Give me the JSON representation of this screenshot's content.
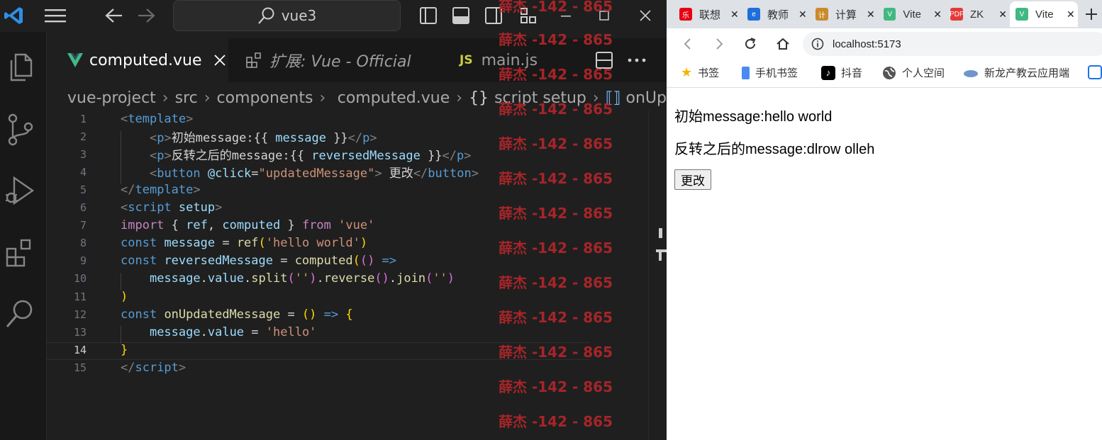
{
  "vscode": {
    "search_text": "vue3",
    "tabs": [
      {
        "label": "computed.vue",
        "icon": "vue-icon",
        "active": true
      },
      {
        "label": "扩展: Vue - Official",
        "icon": "extensions-icon",
        "active": false
      },
      {
        "label": "main.js",
        "icon": "js-file-icon",
        "active": false
      }
    ],
    "breadcrumb": [
      "vue-project",
      "src",
      "components",
      "computed.vue",
      "script setup",
      "onUp"
    ],
    "current_line": 14,
    "lines": [
      {
        "n": "1",
        "parts": [
          [
            "t-br",
            "<"
          ],
          [
            "t-tag",
            "template"
          ],
          [
            "t-br",
            ">"
          ]
        ]
      },
      {
        "n": "2",
        "parts": [
          [
            "t-txt",
            "    "
          ],
          [
            "t-br",
            "<"
          ],
          [
            "t-tag",
            "p"
          ],
          [
            "t-br",
            ">"
          ],
          [
            "t-txt",
            "初始message:{{ "
          ],
          [
            "t-var",
            "message"
          ],
          [
            "t-txt",
            " }}"
          ],
          [
            "t-br",
            "</"
          ],
          [
            "t-tag",
            "p"
          ],
          [
            "t-br",
            ">"
          ]
        ]
      },
      {
        "n": "3",
        "parts": [
          [
            "t-txt",
            "    "
          ],
          [
            "t-br",
            "<"
          ],
          [
            "t-tag",
            "p"
          ],
          [
            "t-br",
            ">"
          ],
          [
            "t-txt",
            "反转之后的message:{{ "
          ],
          [
            "t-var",
            "reversedMessage"
          ],
          [
            "t-txt",
            " }}"
          ],
          [
            "t-br",
            "</"
          ],
          [
            "t-tag",
            "p"
          ],
          [
            "t-br",
            ">"
          ]
        ]
      },
      {
        "n": "4",
        "parts": [
          [
            "t-txt",
            "    "
          ],
          [
            "t-br",
            "<"
          ],
          [
            "t-tag",
            "button"
          ],
          [
            "t-txt",
            " "
          ],
          [
            "t-attr",
            "@click"
          ],
          [
            "t-op",
            "="
          ],
          [
            "t-str",
            "\"updatedMessage\""
          ],
          [
            "t-br",
            ">"
          ],
          [
            "t-txt",
            " 更改"
          ],
          [
            "t-br",
            "</"
          ],
          [
            "t-tag",
            "button"
          ],
          [
            "t-br",
            ">"
          ]
        ]
      },
      {
        "n": "5",
        "parts": [
          [
            "t-br",
            "</"
          ],
          [
            "t-tag",
            "template"
          ],
          [
            "t-br",
            ">"
          ]
        ]
      },
      {
        "n": "6",
        "parts": [
          [
            "t-br",
            "<"
          ],
          [
            "t-tag",
            "script"
          ],
          [
            "t-txt",
            " "
          ],
          [
            "t-attr",
            "setup"
          ],
          [
            "t-br",
            ">"
          ]
        ]
      },
      {
        "n": "7",
        "parts": [
          [
            "t-kw",
            "import"
          ],
          [
            "t-txt",
            " { "
          ],
          [
            "t-var",
            "ref"
          ],
          [
            "t-txt",
            ", "
          ],
          [
            "t-var",
            "computed"
          ],
          [
            "t-txt",
            " } "
          ],
          [
            "t-kw",
            "from"
          ],
          [
            "t-txt",
            " "
          ],
          [
            "t-str",
            "'vue'"
          ]
        ]
      },
      {
        "n": "8",
        "parts": [
          [
            "t-dec",
            "const"
          ],
          [
            "t-txt",
            " "
          ],
          [
            "t-var",
            "message"
          ],
          [
            "t-op",
            " = "
          ],
          [
            "t-fn",
            "ref"
          ],
          [
            "t-yb",
            "("
          ],
          [
            "t-str",
            "'hello world'"
          ],
          [
            "t-yb",
            ")"
          ]
        ]
      },
      {
        "n": "9",
        "parts": [
          [
            "t-dec",
            "const"
          ],
          [
            "t-txt",
            " "
          ],
          [
            "t-var",
            "reversedMessage"
          ],
          [
            "t-op",
            " = "
          ],
          [
            "t-fn",
            "computed"
          ],
          [
            "t-yb",
            "("
          ],
          [
            "t-pb",
            "()"
          ],
          [
            "t-dec",
            " =>"
          ]
        ]
      },
      {
        "n": "10",
        "parts": [
          [
            "t-txt",
            "    "
          ],
          [
            "t-var",
            "message"
          ],
          [
            "t-txt",
            "."
          ],
          [
            "t-var",
            "value"
          ],
          [
            "t-txt",
            "."
          ],
          [
            "t-fn",
            "split"
          ],
          [
            "t-pb",
            "("
          ],
          [
            "t-str",
            "''"
          ],
          [
            "t-pb",
            ")"
          ],
          [
            "t-txt",
            "."
          ],
          [
            "t-fn",
            "reverse"
          ],
          [
            "t-pb",
            "()"
          ],
          [
            "t-txt",
            "."
          ],
          [
            "t-fn",
            "join"
          ],
          [
            "t-pb",
            "("
          ],
          [
            "t-str",
            "''"
          ],
          [
            "t-pb",
            ")"
          ]
        ]
      },
      {
        "n": "11",
        "parts": [
          [
            "t-yb",
            ")"
          ]
        ]
      },
      {
        "n": "12",
        "parts": [
          [
            "t-dec",
            "const"
          ],
          [
            "t-txt",
            " "
          ],
          [
            "t-fn",
            "onUpdatedMessage"
          ],
          [
            "t-op",
            " = "
          ],
          [
            "t-yb",
            "()"
          ],
          [
            "t-dec",
            " =>"
          ],
          [
            "t-txt",
            " "
          ],
          [
            "t-yb",
            "{"
          ]
        ]
      },
      {
        "n": "13",
        "parts": [
          [
            "t-txt",
            "    "
          ],
          [
            "t-var",
            "message"
          ],
          [
            "t-txt",
            "."
          ],
          [
            "t-var",
            "value"
          ],
          [
            "t-op",
            " = "
          ],
          [
            "t-str",
            "'hello'"
          ]
        ]
      },
      {
        "n": "14",
        "parts": [
          [
            "t-yb",
            "}"
          ]
        ]
      },
      {
        "n": "15",
        "parts": [
          [
            "t-br",
            "</"
          ],
          [
            "t-tag",
            "script"
          ],
          [
            "t-br",
            ">"
          ]
        ]
      }
    ]
  },
  "browser": {
    "tabs": [
      {
        "label": "联想",
        "color": "#e60012",
        "glyph": "乐"
      },
      {
        "label": "教师",
        "color": "#1e6fd9",
        "glyph": "e"
      },
      {
        "label": "计算",
        "color": "#c98a2c",
        "glyph": "计"
      },
      {
        "label": "Vite",
        "color": "#41b883",
        "glyph": "V"
      },
      {
        "label": "ZK",
        "color": "#e53935",
        "glyph": "PDF"
      },
      {
        "label": "Vite",
        "color": "#41b883",
        "glyph": "V",
        "active": true
      }
    ],
    "url": "localhost:5173",
    "bookmarks": [
      "书签",
      "手机书签",
      "抖音",
      "个人空间",
      "新龙产教云应用端"
    ],
    "content": {
      "line1": "初始message:hello world",
      "line2": "反转之后的message:dlrow olleh",
      "button": "更改"
    }
  },
  "watermark": {
    "text": "薛杰 -142 - 865"
  }
}
